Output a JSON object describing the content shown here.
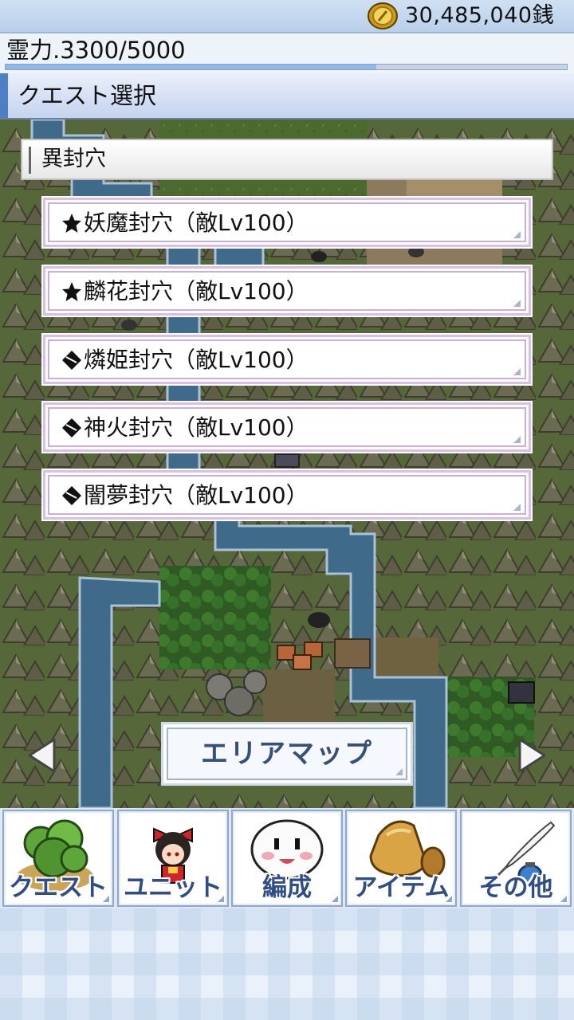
{
  "header": {
    "money": "30,485,040銭",
    "coin_icon": "gold-coin-icon"
  },
  "spirit": {
    "label": "霊力.3300/5000",
    "current": 3300,
    "max": 5000
  },
  "section": {
    "title": "クエスト選択"
  },
  "area": {
    "name": "異封穴"
  },
  "quests": [
    {
      "mark": "star",
      "label": "妖魔封穴（敵Lv100）"
    },
    {
      "mark": "star",
      "label": "麟花封穴（敵Lv100）"
    },
    {
      "mark": "diamond",
      "label": "燐姫封穴（敵Lv100）"
    },
    {
      "mark": "diamond",
      "label": "神火封穴（敵Lv100）"
    },
    {
      "mark": "diamond",
      "label": "闇夢封穴（敵Lv100）"
    }
  ],
  "area_map_button": "エリアマップ",
  "nav": [
    {
      "label": "クエスト",
      "icon": "tree-icon"
    },
    {
      "label": "ユニット",
      "icon": "shrine-maiden-icon"
    },
    {
      "label": "編成",
      "icon": "yukkuri-face-icon"
    },
    {
      "label": "アイテム",
      "icon": "bag-icon"
    },
    {
      "label": "その他",
      "icon": "quill-ink-icon"
    }
  ],
  "colors": {
    "accent": "#4d7fc4",
    "button_border": "#d7bfe6",
    "nav_text": "#2f4d86"
  }
}
